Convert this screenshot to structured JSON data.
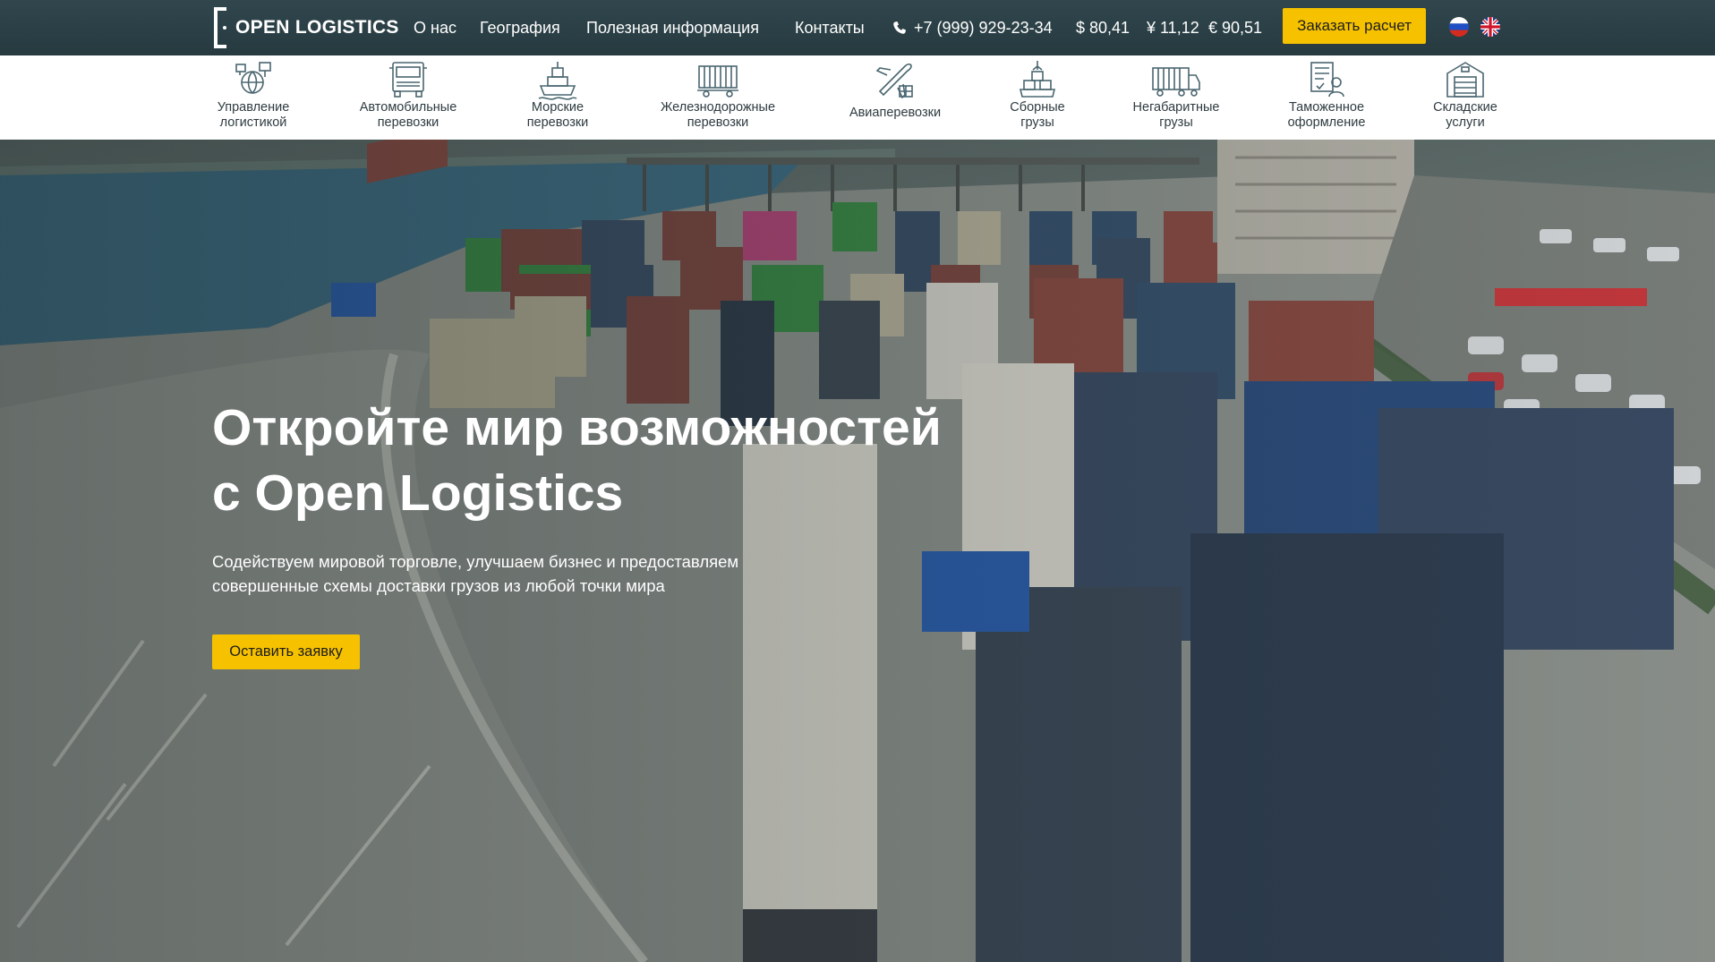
{
  "brand": {
    "logo_text": "OPEN LOGISTICS"
  },
  "nav": {
    "about": "О нас",
    "geography": "География",
    "info": "Полезная информация",
    "contacts": "Контакты",
    "phone": "+7 (999) 929-23-34",
    "usd": "$ 80,41",
    "cny": "¥ 11,12",
    "eur": "€ 90,51",
    "order_button": "Заказать расчет"
  },
  "languages": [
    "ru",
    "en"
  ],
  "services": [
    {
      "line1": "Управление",
      "line2": "логистикой",
      "icon": "logistics-management-icon"
    },
    {
      "line1": "Автомобильные",
      "line2": "перевозки",
      "icon": "truck-icon"
    },
    {
      "line1": "Морские",
      "line2": "перевозки",
      "icon": "ship-icon"
    },
    {
      "line1": "Железнодорожные",
      "line2": "перевозки",
      "icon": "rail-wagon-icon"
    },
    {
      "line1": "Авиаперевозки",
      "line2": "",
      "icon": "airplane-icon"
    },
    {
      "line1": "Сборные",
      "line2": "грузы",
      "icon": "consolidated-cargo-icon"
    },
    {
      "line1": "Негабаритные",
      "line2": "грузы",
      "icon": "oversized-cargo-icon"
    },
    {
      "line1": "Таможенное",
      "line2": "оформление",
      "icon": "customs-icon"
    },
    {
      "line1": "Складские",
      "line2": "услуги",
      "icon": "warehouse-icon"
    }
  ],
  "hero": {
    "title_line1": "Откройте мир возможностей",
    "title_line2": "с Open Logistics",
    "subtitle_line1": "Содействуем мировой торговле, улучшаем бизнес и предоставляем",
    "subtitle_line2": "совершенные схемы доставки грузов из любой точки мира",
    "cta": "Оставить заявку"
  },
  "colors": {
    "topbar": "#2b4046",
    "accent": "#f6c200",
    "icon_stroke": "#4a6670"
  }
}
